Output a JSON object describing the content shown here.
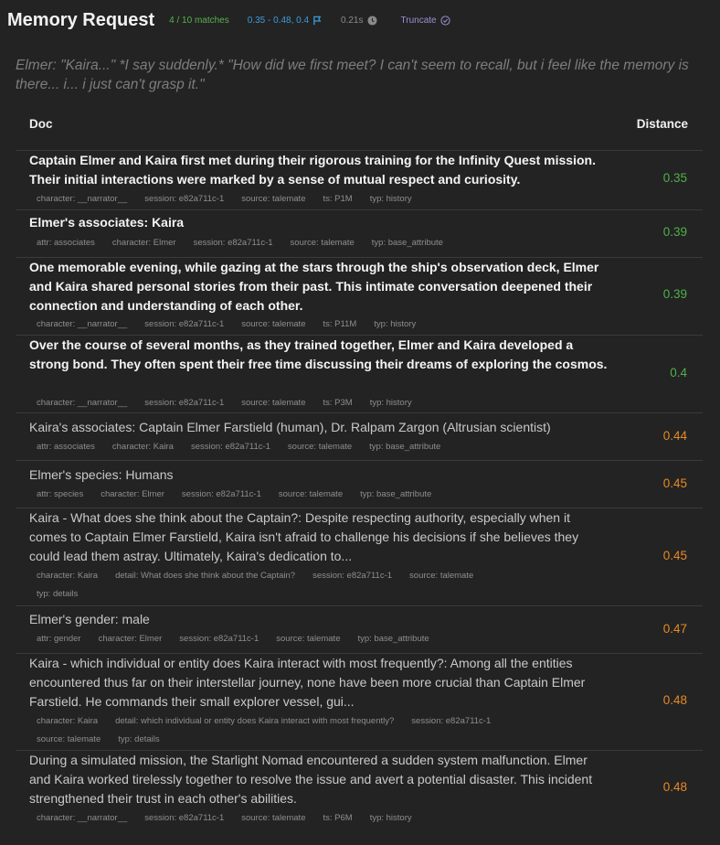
{
  "header": {
    "title": "Memory Request",
    "matches": "4 / 10 matches",
    "range": "0.35 - 0.48, 0.4",
    "time": "0.21s",
    "truncate": "Truncate"
  },
  "query": "Elmer: \"Kaira...\" *I say suddenly.* \"How did we first meet? I can't seem to recall, but i feel like the memory is there... i... i just can't grasp it.\"",
  "table": {
    "col_doc": "Doc",
    "col_distance": "Distance",
    "rows": [
      {
        "text": "Captain Elmer and Kaira first met during their rigorous training for the Infinity Quest mission. Their initial interactions were marked by a sense of mutual respect and curiosity.",
        "meta": [
          "character: __narrator__",
          "session: e82a711c-1",
          "source: talemate",
          "ts: P1M",
          "typ: history"
        ],
        "distance": "0.35"
      },
      {
        "text": "Elmer's associates: Kaira",
        "meta": [
          "attr: associates",
          "character: Elmer",
          "session: e82a711c-1",
          "source: talemate",
          "typ: base_attribute"
        ],
        "distance": "0.39"
      },
      {
        "text": "One memorable evening, while gazing at the stars through the ship's observation deck, Elmer and Kaira shared personal stories from their past. This intimate conversation deepened their connection and understanding of each other.",
        "meta": [
          "character: __narrator__",
          "session: e82a711c-1",
          "source: talemate",
          "ts: P11M",
          "typ: history"
        ],
        "distance": "0.39"
      },
      {
        "text": "Over the course of several months, as they trained together, Elmer and Kaira developed a strong bond. They often spent their free time discussing their dreams of exploring the cosmos.",
        "meta": [
          "character: __narrator__",
          "session: e82a711c-1",
          "source: talemate",
          "ts: P3M",
          "typ: history"
        ],
        "distance": "0.4"
      },
      {
        "text": "Kaira's associates: Captain Elmer Farstield (human), Dr. Ralpam Zargon (Altrusian scientist)",
        "meta": [
          "attr: associates",
          "character: Kaira",
          "session: e82a711c-1",
          "source: talemate",
          "typ: base_attribute"
        ],
        "distance": "0.44"
      },
      {
        "text": "Elmer's species: Humans",
        "meta": [
          "attr: species",
          "character: Elmer",
          "session: e82a711c-1",
          "source: talemate",
          "typ: base_attribute"
        ],
        "distance": "0.45"
      },
      {
        "text": "Kaira - What does she think about the Captain?: Despite respecting authority, especially when it comes to Captain Elmer Farstield, Kaira isn't afraid to challenge his decisions if she believes they could lead them astray. Ultimately, Kaira's dedication to...",
        "meta": [
          "character: Kaira",
          "detail: What does she think about the Captain?",
          "session: e82a711c-1",
          "source: talemate",
          "typ: details"
        ],
        "distance": "0.45"
      },
      {
        "text": "Elmer's gender: male",
        "meta": [
          "attr: gender",
          "character: Elmer",
          "session: e82a711c-1",
          "source: talemate",
          "typ: base_attribute"
        ],
        "distance": "0.47"
      },
      {
        "text": "Kaira - which individual or entity does Kaira interact with most frequently?: Among all the entities encountered thus far on their interstellar journey, none have been more crucial than Captain Elmer Farstield. He commands their small explorer vessel, gui...",
        "meta": [
          "character: Kaira",
          "detail: which individual or entity does Kaira interact with most frequently?",
          "session: e82a711c-1",
          "source: talemate",
          "typ: details"
        ],
        "distance": "0.48"
      },
      {
        "text": "During a simulated mission, the Starlight Nomad encountered a sudden system malfunction. Elmer and Kaira worked tirelessly together to resolve the issue and avert a potential disaster. This incident strengthened their trust in each other's abilities.",
        "meta": [
          "character: __narrator__",
          "session: e82a711c-1",
          "source: talemate",
          "ts: P6M",
          "typ: history"
        ],
        "distance": "0.48"
      }
    ]
  }
}
